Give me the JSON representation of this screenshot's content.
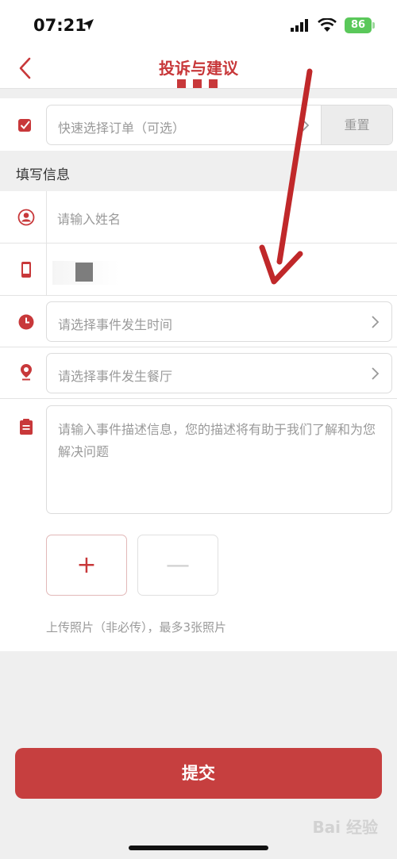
{
  "status_bar": {
    "time": "07:21",
    "battery": "86"
  },
  "nav": {
    "title": "投诉与建议"
  },
  "order": {
    "placeholder": "快速选择订单（可选）",
    "reset_label": "重置"
  },
  "section": {
    "title": "填写信息"
  },
  "form": {
    "name_placeholder": "请输入姓名",
    "time_placeholder": "请选择事件发生时间",
    "restaurant_placeholder": "请选择事件发生餐厅",
    "description_placeholder": "请输入事件描述信息，您的描述将有助于我们了解和为您解决问题"
  },
  "upload": {
    "add_label": "+",
    "remove_label": "—",
    "hint": "上传照片（非必传），最多3张照片"
  },
  "submit_label": "提交",
  "watermark": "Bai 经验",
  "colors": {
    "accent": "#c8383a",
    "submit": "#c63f3f",
    "placeholder": "#9a9a9a"
  },
  "icons": [
    "location-arrow-icon",
    "signal-icon",
    "wifi-icon",
    "battery-icon",
    "back-chevron-icon",
    "checkbox-icon",
    "user-icon",
    "phone-icon",
    "clock-icon",
    "location-pin-icon",
    "clipboard-icon",
    "chevron-right-icon"
  ]
}
